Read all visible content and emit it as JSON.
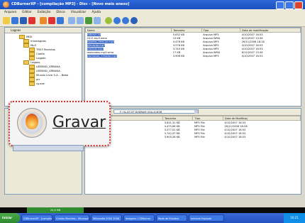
{
  "window": {
    "title": "CDBurnerXP - [compilação MP3] - Disc - [Novo meio anexo]"
  },
  "menu": [
    "Arquivo",
    "Editar",
    "Exibição",
    "Disco",
    "Visualizar",
    "Ajuda"
  ],
  "explorer": {
    "address": "Lagoas",
    "tree": [
      {
        "label": "MIDI",
        "indent": 0
      },
      {
        "label": "minelagoas",
        "indent": 1
      },
      {
        "label": "Mp3",
        "indent": 1
      },
      {
        "label": "TR03 Revistas",
        "indent": 2
      },
      {
        "label": "Cadits",
        "indent": 2
      },
      {
        "label": "Lagoas",
        "indent": 2
      },
      {
        "label": "Lagoas",
        "indent": 1
      },
      {
        "label": "LBSMAD_URBANA",
        "indent": 2
      },
      {
        "label": "LBSMAD_URBANA",
        "indent": 2
      },
      {
        "label": "Mundo Livre S.A. - Bebe",
        "indent": 2
      },
      {
        "label": "pic",
        "indent": 2
      },
      {
        "label": "rg.exe",
        "indent": 2
      }
    ],
    "columns": [
      "Nome",
      "Tamanho",
      "Tipo",
      "Data de modificação"
    ],
    "files": [
      {
        "name": "autorun.inf",
        "size": "5.632 KB",
        "type": "Arquivo MP3",
        "date": "4/10/2007 16:53",
        "selected": true
      },
      {
        "name": "2012.mp3.wma",
        "size": "15 KB",
        "type": "Arquivo WMA",
        "date": "6/12/2007 13:34",
        "selected": false
      },
      {
        "name": "baladas_nerd-jul.mp3",
        "size": "4.476 KB",
        "type": "Arquivo MP3",
        "date": "26/11/2006 18:18",
        "selected": true
      },
      {
        "name": "gravacao.mp3",
        "size": "3.578 KB",
        "type": "Arquivo MP3",
        "date": "4/10/2007 16:53",
        "selected": true
      },
      {
        "name": "praticas.mp3",
        "size": "3.740 KB",
        "type": "Arquivo MP3",
        "date": "4/10/2007 16:53",
        "selected": true
      },
      {
        "name": "reoleaidos.mp3.wma",
        "size": "17 KB",
        "type": "Arquivo WMA",
        "date": "6/12/2007 13:34",
        "selected": false
      },
      {
        "name": "promocao_mirador.mp3",
        "size": "3.906 KB",
        "type": "Arquivo MP3",
        "date": "4/10/2007 16:53",
        "selected": true
      }
    ]
  },
  "compilation": {
    "drive": "F: HL-DT-ST DVDRAM GSA-4163B",
    "columns": [
      "Nome",
      "Tamanho",
      "Tipo",
      "Data de Modificaç"
    ],
    "files": [
      {
        "name": "Wp3",
        "size": "3.631,31 KB",
        "type": "MP3 File",
        "date": "4/10/2007 16:53"
      },
      {
        "name": "baladas.mp3",
        "size": "4.475,66 KB",
        "type": "MP3 File",
        "date": "26/11/2006 18:28"
      },
      {
        "name": "Mp3",
        "size": "3.577,02 KB",
        "type": "MP3 File",
        "date": "4/10/2007 16:53"
      },
      {
        "name": "Mp3",
        "size": "3.742,07 KB",
        "type": "MP3 File",
        "date": "4/10/2007 16:53"
      },
      {
        "name": "promocao.mp3",
        "size": "3.905,28 KB",
        "type": "MP3 File",
        "date": "4/10/2007 16:53"
      }
    ]
  },
  "popup": {
    "label": "Gravar"
  },
  "status": {
    "used": "20,6 MB"
  },
  "taskbar": {
    "start": "Iniciar",
    "tasks": [
      "CDBurnerXP - [compilaç",
      "Contas Movidas - Microsoft",
      "Wikipedia 2000 2008",
      "imagens / CDBurner",
      "Rede de Estudos",
      "Internet Explorer"
    ],
    "clock": "16:21"
  },
  "colors": {
    "selection": "#3162c4",
    "title": "#2f68d8",
    "popup_border": "#cc3333"
  }
}
